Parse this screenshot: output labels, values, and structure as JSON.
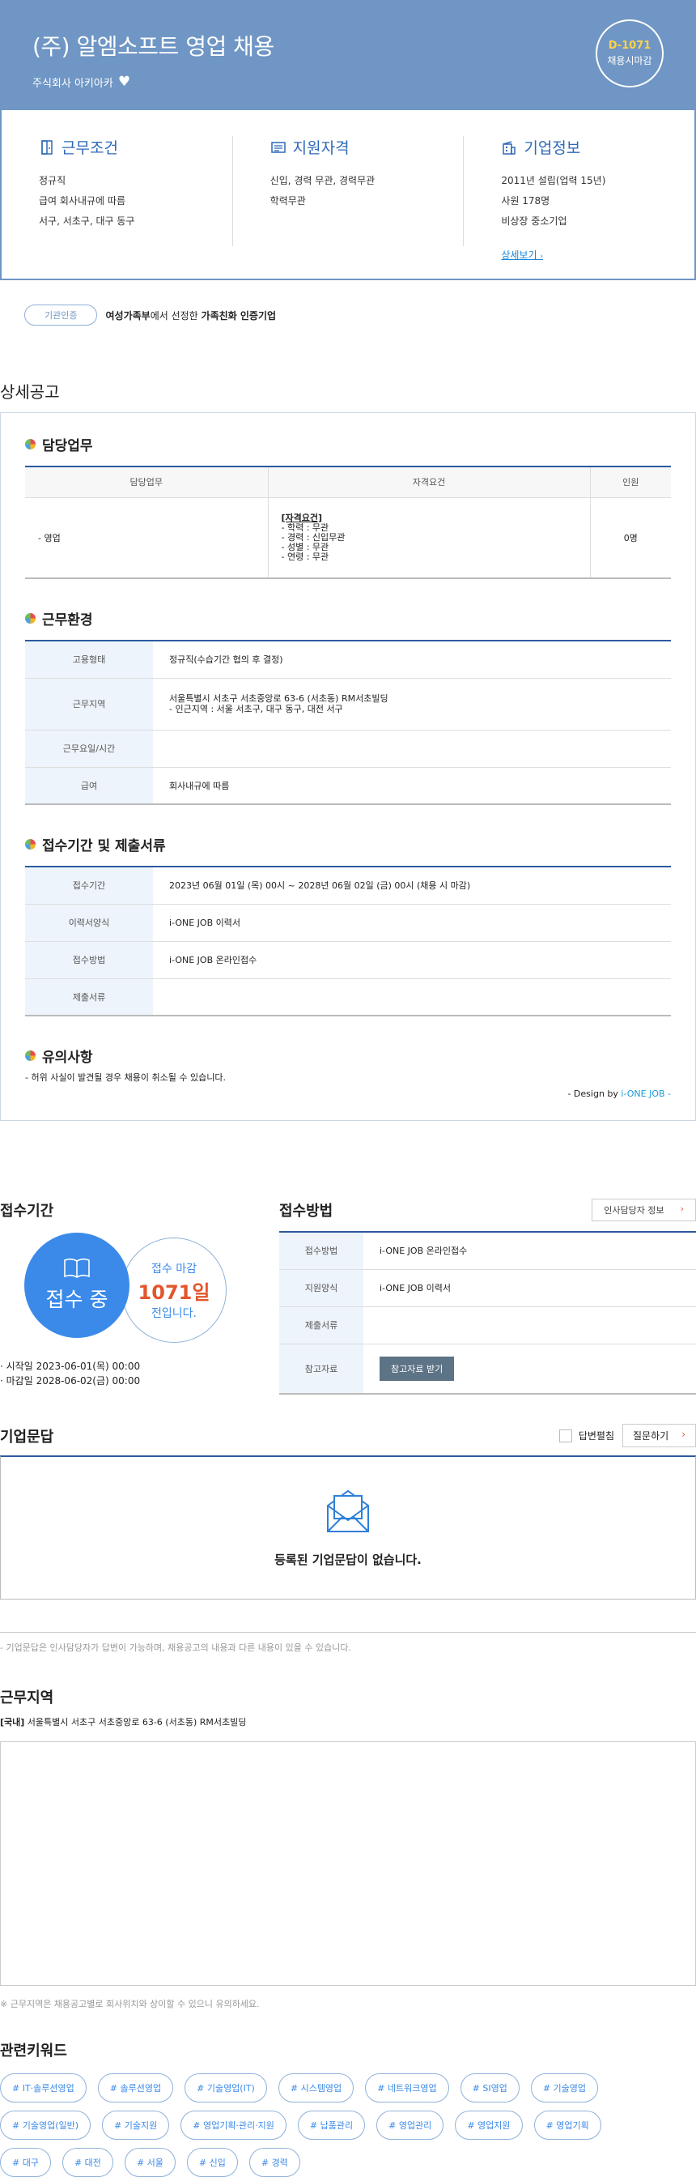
{
  "header": {
    "title": "(주) 알엠소프트 영업 채용",
    "company": "주식회사 아키아카",
    "dday_code": "D-1071",
    "dday_text": "채용시마감"
  },
  "info": {
    "work": {
      "title": "근무조건",
      "lines": [
        "정규직",
        "급여 회사내규에 따름",
        "서구, 서초구, 대구 동구"
      ]
    },
    "qual": {
      "title": "지원자격",
      "lines": [
        "신입, 경력 무관, 경력무관",
        "학력무관"
      ]
    },
    "corp": {
      "title": "기업정보",
      "lines": [
        "2011년 설립(업력 15년)",
        "사원 178명",
        "비상장 중소기업"
      ],
      "more": "상세보기"
    }
  },
  "cert": {
    "badge": "기관인증",
    "lead": "여성가족부",
    "mid": "에서 선정한 ",
    "tail": "가족친화 인증기업"
  },
  "detail": {
    "page_title": "상세공고",
    "duties": {
      "title": "담당업무",
      "headers": [
        "담당업무",
        "자격요건",
        "인원"
      ],
      "row": {
        "duty": "- 영업",
        "req_title": "[자격요건]",
        "req_lines": [
          "- 학력 : 무관",
          "- 경력 : 신입무관",
          "- 성별 : 무관",
          "- 연령 : 무관"
        ],
        "count": "0명"
      }
    },
    "env": {
      "title": "근무환경",
      "rows": [
        {
          "label": "고용형태",
          "value": "정규직(수습기간 협의 후 결정)"
        },
        {
          "label": "근무지역",
          "value": "서울특별시 서초구 서초중앙로 63-6 (서초동) RM서초빌딩",
          "value2": "- 인근지역 : 서울 서초구, 대구 동구, 대전 서구"
        },
        {
          "label": "근무요일/시간",
          "value": ""
        },
        {
          "label": "급여",
          "value": "회사내규에 따름"
        }
      ]
    },
    "period": {
      "title": "접수기간 및 제출서류",
      "rows": [
        {
          "label": "접수기간",
          "value": "2023년 06월 01일 (목) 00시 ~ 2028년 06월 02일 (금) 00시 (채용 시 마감)"
        },
        {
          "label": "이력서양식",
          "value": "i-ONE JOB 이력서"
        },
        {
          "label": "접수방법",
          "value": "i-ONE JOB 온라인접수"
        },
        {
          "label": "제출서류",
          "value": ""
        }
      ]
    },
    "caution": {
      "title": "유의사항",
      "text": "- 허위 사실이 발견될 경우 채용이 취소될 수 있습니다."
    },
    "design": {
      "prefix": "- Design by ",
      "brand": "i-ONE JOB",
      "suffix": " -"
    }
  },
  "apply": {
    "period_title": "접수기간",
    "status": "접수 중",
    "deadline_label": "접수 마감",
    "days": "1071일",
    "days_suffix": "전입니다.",
    "start": "· 시작일 2023-06-01(목) 00:00",
    "end": "· 마감일 2028-06-02(금) 00:00",
    "method_title": "접수방법",
    "hr_btn": "인사담당자 정보",
    "rows": [
      {
        "label": "접수방법",
        "value": "i-ONE JOB 온라인접수"
      },
      {
        "label": "지원양식",
        "value": "i-ONE JOB 이력서"
      },
      {
        "label": "제출서류",
        "value": ""
      },
      {
        "label": "참고자료",
        "btn": "참고자료 받기"
      }
    ]
  },
  "qa": {
    "title": "기업문답",
    "answer_toggle": "답변펼침",
    "ask_btn": "질문하기",
    "empty": "등록된 기업문답이 없습니다.",
    "foot": "- 기업문답은 인사담당자가 답변이 가능하며, 채용공고의 내용과 다른 내용이 있을 수 있습니다."
  },
  "location": {
    "title": "근무지역",
    "tag": "[국내]",
    "addr": " 서울특별시 서초구 서초중앙로 63-6 (서초동) RM서초빌딩",
    "note": "※ 근무지역은 채용공고별로 회사위치와 상이할 수 있으니 유의하세요."
  },
  "keywords": {
    "title": "관련키워드",
    "items": [
      "# IT·솔루션영업",
      "# 솔루션영업",
      "# 기술영업(IT)",
      "# 시스템영업",
      "# 네트워크영업",
      "# SI영업",
      "# 기술영업",
      "# 기술영업(일반)",
      "# 기술지원",
      "# 영업기획·관리·지원",
      "# 납품관리",
      "# 영업관리",
      "# 영업지원",
      "# 영업기획",
      "# 대구",
      "# 대전",
      "# 서울",
      "# 신입",
      "# 경력"
    ]
  }
}
